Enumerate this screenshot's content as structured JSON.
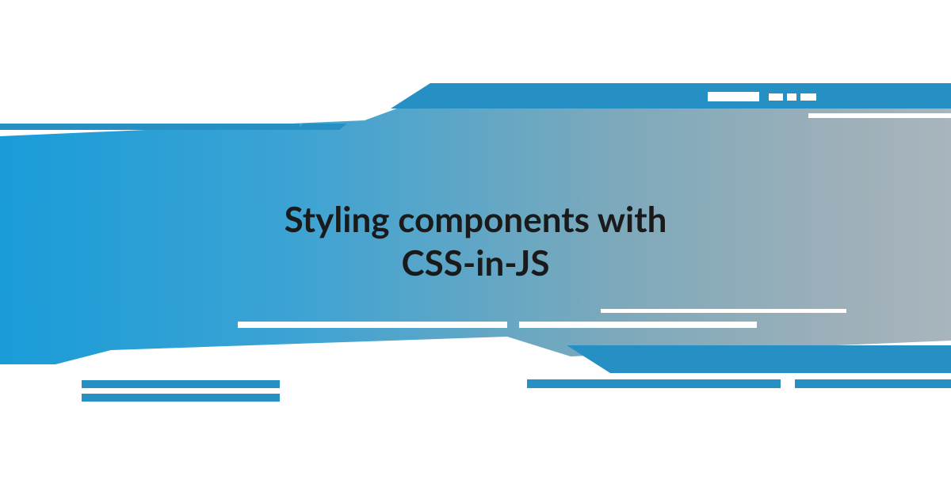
{
  "title": {
    "line1": "Styling components with",
    "line2": "CSS-in-JS"
  }
}
